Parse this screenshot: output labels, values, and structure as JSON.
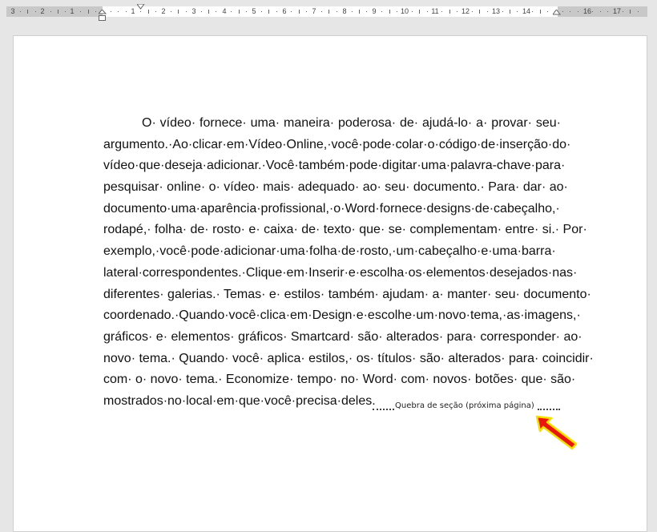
{
  "ruler": {
    "numbers": [
      "3",
      "2",
      "1",
      "1",
      "2",
      "3",
      "4",
      "5",
      "6",
      "7",
      "8",
      "9",
      "10",
      "11",
      "12",
      "13",
      "14",
      "16",
      "17"
    ]
  },
  "document": {
    "lines": [
      "O· vídeo· fornece· uma· maneira· poderosa· de· ajudá-lo· a· provar· seu·",
      "argumento.·Ao·clicar·em·Vídeo·Online,·você·pode·colar·o·código·de·inserção·do·",
      "vídeo·que·deseja·adicionar.·Você·também·pode·digitar·uma·palavra-chave·para·",
      "pesquisar· online· o· vídeo· mais· adequado· ao· seu· documento.· Para· dar· ao·",
      "documento·uma·aparência·profissional,·o·Word·fornece·designs·de·cabeçalho,·",
      "rodapé,· folha· de· rosto· e· caixa· de· texto· que· se· complementam· entre· si.· Por·",
      "exemplo,·você·pode·adicionar·uma·folha·de·rosto,·um·cabeçalho·e·uma·barra·",
      "lateral·correspondentes.·Clique·em·Inserir·e·escolha·os·elementos·desejados·nas·",
      "diferentes· galerias.· Temas· e· estilos· também· ajudam· a· manter· seu· documento·",
      "coordenado.·Quando·você·clica·em·Design·e·escolhe·um·novo·tema,·as·imagens,·",
      "gráficos· e· elementos· gráficos· Smartcard· são· alterados· para· corresponder· ao·",
      "novo· tema.· Quando· você· aplica· estilos,· os· títulos· são· alterados· para· coincidir·",
      "com· o· novo· tema.· Economize· tempo· no· Word· com· novos· botões· que· são·",
      "mostrados·no·local·em·que·você·precisa·deles."
    ],
    "section_break_label": "Quebra de seção (próxima página)"
  },
  "colors": {
    "arrow_fill": "#e8160c",
    "arrow_outline": "#f5e000"
  }
}
